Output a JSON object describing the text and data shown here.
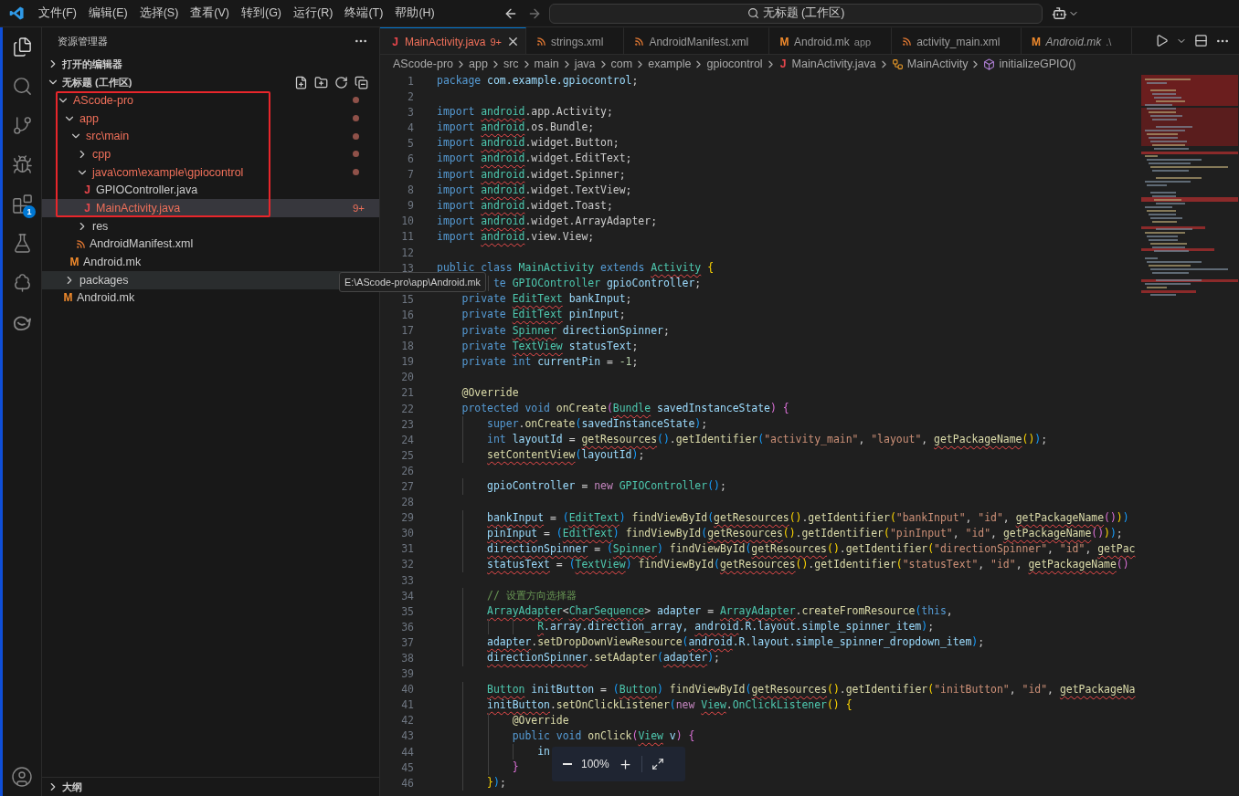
{
  "title_bar": {
    "menu": [
      "文件(F)",
      "编辑(E)",
      "选择(S)",
      "查看(V)",
      "转到(G)",
      "运行(R)",
      "终端(T)",
      "帮助(H)"
    ],
    "command_center": "无标题 (工作区)"
  },
  "activity_bar": {
    "items": [
      {
        "kind": "files",
        "selected": true
      },
      {
        "kind": "search",
        "selected": false
      },
      {
        "kind": "scm",
        "selected": false
      },
      {
        "kind": "debug",
        "selected": false
      },
      {
        "kind": "extensions",
        "selected": false,
        "badge": "1"
      },
      {
        "kind": "testing",
        "selected": false
      },
      {
        "kind": "tree",
        "selected": false
      },
      {
        "kind": "whale",
        "selected": false
      }
    ]
  },
  "sidebar": {
    "title": "资源管理器",
    "sections": [
      {
        "title": "打开的编辑器",
        "expanded": false
      },
      {
        "title": "无标题 (工作区)",
        "expanded": true,
        "tree": [
          {
            "name": "AScode-pro",
            "kind": "folder",
            "expanded": true,
            "modified": true,
            "selected": false,
            "hovered": false,
            "children": [
              {
                "name": "app",
                "kind": "folder",
                "expanded": true,
                "modified": true,
                "selected": false,
                "hovered": false,
                "children": [
                  {
                    "name": "src\\main",
                    "kind": "folder",
                    "expanded": true,
                    "modified": true,
                    "selected": false,
                    "hovered": false,
                    "children": [
                      {
                        "name": "cpp",
                        "kind": "folder",
                        "expanded": false,
                        "modified": true,
                        "selected": false,
                        "hovered": false
                      },
                      {
                        "name": "java\\com\\example\\gpiocontrol",
                        "kind": "folder",
                        "expanded": true,
                        "modified": true,
                        "selected": false,
                        "hovered": false,
                        "children": [
                          {
                            "name": "GPIOController.java",
                            "kind": "java",
                            "icon": "J",
                            "modified": false,
                            "selected": false,
                            "hovered": false
                          },
                          {
                            "name": "MainActivity.java",
                            "kind": "java",
                            "icon": "J",
                            "modified": true,
                            "problems": "9+",
                            "selected": true,
                            "hovered": false
                          }
                        ]
                      },
                      {
                        "name": "res",
                        "kind": "folder",
                        "expanded": false,
                        "modified": false,
                        "selected": false,
                        "hovered": false
                      },
                      {
                        "name": "AndroidManifest.xml",
                        "kind": "xml",
                        "modified": false,
                        "selected": false,
                        "hovered": false
                      }
                    ]
                  },
                  {
                    "name": "Android.mk",
                    "kind": "mk",
                    "icon": "M",
                    "modified": false,
                    "selected": false,
                    "hovered": false
                  }
                ]
              },
              {
                "name": "packages",
                "kind": "folder",
                "expanded": false,
                "modified": false,
                "selected": false,
                "hovered": true
              },
              {
                "name": "Android.mk",
                "kind": "mk",
                "icon": "M",
                "modified": false,
                "selected": false,
                "hovered": false
              }
            ]
          }
        ]
      }
    ],
    "outline": {
      "title": "大纲",
      "expanded": false
    }
  },
  "editor": {
    "tabs": [
      {
        "label": "MainActivity.java",
        "kind": "java",
        "icon": "J",
        "problems": "9+",
        "selected": true,
        "preview": false
      },
      {
        "label": "strings.xml",
        "kind": "xml",
        "selected": false,
        "preview": false
      },
      {
        "label": "AndroidManifest.xml",
        "kind": "xml",
        "selected": false,
        "preview": false
      },
      {
        "label": "Android.mk",
        "description": "app",
        "kind": "mk",
        "icon": "M",
        "selected": false,
        "preview": false
      },
      {
        "label": "activity_main.xml",
        "kind": "xml",
        "selected": false,
        "preview": false
      },
      {
        "label": "Android.mk",
        "description": ".\\",
        "kind": "mk",
        "icon": "M",
        "selected": false,
        "preview": true
      }
    ],
    "breadcrumb": [
      {
        "label": "AScode-pro",
        "kind": "folder"
      },
      {
        "label": "app",
        "kind": "folder"
      },
      {
        "label": "src",
        "kind": "folder"
      },
      {
        "label": "main",
        "kind": "folder"
      },
      {
        "label": "java",
        "kind": "folder"
      },
      {
        "label": "com",
        "kind": "folder"
      },
      {
        "label": "example",
        "kind": "folder"
      },
      {
        "label": "gpiocontrol",
        "kind": "folder"
      },
      {
        "label": "MainActivity.java",
        "kind": "java",
        "icon": "J"
      },
      {
        "label": "MainActivity",
        "kind": "class"
      },
      {
        "label": "initializeGPIO()",
        "kind": "method"
      }
    ],
    "lines": [
      {
        "number": "1",
        "tokens": [
          {
            "text": "package ",
            "kind": "kw"
          },
          {
            "text": "com.example.gpiocontrol",
            "kind": "var"
          },
          {
            "text": ";",
            "kind": "txt"
          }
        ]
      },
      {
        "number": "2"
      },
      {
        "number": "3",
        "tokens": [
          {
            "text": "import ",
            "kind": "kw"
          },
          {
            "text": "android",
            "kind": "type_err"
          },
          {
            "text": ".app.Activity;",
            "kind": "txt"
          }
        ]
      },
      {
        "number": "4",
        "tokens": [
          {
            "text": "import ",
            "kind": "kw"
          },
          {
            "text": "android",
            "kind": "type_err"
          },
          {
            "text": ".os.Bundle;",
            "kind": "txt"
          }
        ]
      },
      {
        "number": "5",
        "tokens": [
          {
            "text": "import ",
            "kind": "kw"
          },
          {
            "text": "android",
            "kind": "type_err"
          },
          {
            "text": ".widget.Button;",
            "kind": "txt"
          }
        ]
      },
      {
        "number": "6",
        "tokens": [
          {
            "text": "import ",
            "kind": "kw"
          },
          {
            "text": "android",
            "kind": "type_err"
          },
          {
            "text": ".widget.EditText;",
            "kind": "txt"
          }
        ]
      },
      {
        "number": "7",
        "tokens": [
          {
            "text": "import ",
            "kind": "kw"
          },
          {
            "text": "android",
            "kind": "type_err"
          },
          {
            "text": ".widget.Spinner;",
            "kind": "txt"
          }
        ]
      },
      {
        "number": "8",
        "tokens": [
          {
            "text": "import ",
            "kind": "kw"
          },
          {
            "text": "android",
            "kind": "type_err"
          },
          {
            "text": ".widget.TextView;",
            "kind": "txt"
          }
        ]
      },
      {
        "number": "9",
        "tokens": [
          {
            "text": "import ",
            "kind": "kw"
          },
          {
            "text": "android",
            "kind": "type_err"
          },
          {
            "text": ".widget.Toast;",
            "kind": "txt"
          }
        ]
      },
      {
        "number": "10",
        "tokens": [
          {
            "text": "import ",
            "kind": "kw"
          },
          {
            "text": "android",
            "kind": "type_err"
          },
          {
            "text": ".widget.ArrayAdapter;",
            "kind": "txt"
          }
        ]
      },
      {
        "number": "11",
        "tokens": [
          {
            "text": "import ",
            "kind": "kw"
          },
          {
            "text": "android",
            "kind": "type_err"
          },
          {
            "text": ".view.View;",
            "kind": "txt"
          }
        ]
      },
      {
        "number": "12"
      },
      {
        "number": "13",
        "tokens": [
          {
            "text": "public class ",
            "kind": "kw"
          },
          {
            "text": "MainActivity ",
            "kind": "type"
          },
          {
            "text": "extends ",
            "kind": "kw"
          },
          {
            "text": "Activity",
            "kind": "type_err"
          },
          {
            "text": " {",
            "kind": "p1"
          }
        ]
      },
      {
        "tokens": [
          {
            "text": "         te ",
            "kind": "kw"
          },
          {
            "text": "GPIOController ",
            "kind": "type"
          },
          {
            "text": "gpioController",
            "kind": "var"
          },
          {
            "text": ";",
            "kind": "txt"
          }
        ]
      },
      {
        "number": "15",
        "tokens": [
          {
            "text": "    private ",
            "kind": "kw"
          },
          {
            "text": "EditText",
            "kind": "type_err"
          },
          {
            "text": " bankInput",
            "kind": "var"
          },
          {
            "text": ";",
            "kind": "txt"
          }
        ]
      },
      {
        "number": "16",
        "tokens": [
          {
            "text": "    private ",
            "kind": "kw"
          },
          {
            "text": "EditText",
            "kind": "type_err"
          },
          {
            "text": " pinInput",
            "kind": "var"
          },
          {
            "text": ";",
            "kind": "txt"
          }
        ]
      },
      {
        "number": "17",
        "tokens": [
          {
            "text": "    private ",
            "kind": "kw"
          },
          {
            "text": "Spinner",
            "kind": "type_err"
          },
          {
            "text": " directionSpinner",
            "kind": "var"
          },
          {
            "text": ";",
            "kind": "txt"
          }
        ]
      },
      {
        "number": "18",
        "tokens": [
          {
            "text": "    private ",
            "kind": "kw"
          },
          {
            "text": "TextView",
            "kind": "type_err"
          },
          {
            "text": " statusText",
            "kind": "var"
          },
          {
            "text": ";",
            "kind": "txt"
          }
        ]
      },
      {
        "number": "19",
        "tokens": [
          {
            "text": "    private int ",
            "kind": "kw"
          },
          {
            "text": "currentPin",
            "kind": "var"
          },
          {
            "text": " = ",
            "kind": "txt"
          },
          {
            "text": "-1",
            "kind": "num"
          },
          {
            "text": ";",
            "kind": "txt"
          }
        ]
      },
      {
        "number": "20"
      },
      {
        "number": "21",
        "tokens": [
          {
            "text": "    @Override",
            "kind": "ann"
          }
        ]
      },
      {
        "number": "22",
        "tokens": [
          {
            "text": "    protected void ",
            "kind": "kw"
          },
          {
            "text": "onCreate",
            "kind": "fn"
          },
          {
            "text": "(",
            "kind": "p2"
          },
          {
            "text": "Bundle",
            "kind": "type_err"
          },
          {
            "text": " savedInstanceState",
            "kind": "var"
          },
          {
            "text": ")",
            "kind": "p2"
          },
          {
            "text": " {",
            "kind": "p2"
          }
        ]
      },
      {
        "number": "23",
        "tokens": [
          {
            "text": "        super",
            "kind": "kw"
          },
          {
            "text": ".",
            "kind": "txt"
          },
          {
            "text": "onCreate",
            "kind": "fn"
          },
          {
            "text": "(",
            "kind": "p3"
          },
          {
            "text": "savedInstanceState",
            "kind": "var"
          },
          {
            "text": ")",
            "kind": "p3"
          },
          {
            "text": ";",
            "kind": "txt"
          }
        ]
      },
      {
        "number": "24",
        "tokens": [
          {
            "text": "        int ",
            "kind": "kw"
          },
          {
            "text": "layoutId",
            "kind": "var"
          },
          {
            "text": " = ",
            "kind": "txt"
          },
          {
            "text": "getResources",
            "kind": "fn_err"
          },
          {
            "text": "()",
            "kind": "p3"
          },
          {
            "text": ".",
            "kind": "txt"
          },
          {
            "text": "getIdentifier",
            "kind": "fn"
          },
          {
            "text": "(",
            "kind": "p3"
          },
          {
            "text": "\"activity_main\"",
            "kind": "str"
          },
          {
            "text": ", ",
            "kind": "txt"
          },
          {
            "text": "\"layout\"",
            "kind": "str"
          },
          {
            "text": ", ",
            "kind": "txt"
          },
          {
            "text": "getPackageName",
            "kind": "fn_err"
          },
          {
            "text": "()",
            "kind": "p1"
          },
          {
            "text": ")",
            "kind": "p3"
          },
          {
            "text": ";",
            "kind": "txt"
          }
        ]
      },
      {
        "number": "25",
        "tokens": [
          {
            "text": "        setContentView",
            "kind": "fn_err"
          },
          {
            "text": "(",
            "kind": "p3"
          },
          {
            "text": "layoutId",
            "kind": "var"
          },
          {
            "text": ")",
            "kind": "p3"
          },
          {
            "text": ";",
            "kind": "txt"
          }
        ]
      },
      {
        "number": "26"
      },
      {
        "number": "27",
        "tokens": [
          {
            "text": "        gpioController",
            "kind": "var"
          },
          {
            "text": " = ",
            "kind": "txt"
          },
          {
            "text": "new ",
            "kind": "ctl"
          },
          {
            "text": "GPIOController",
            "kind": "type"
          },
          {
            "text": "()",
            "kind": "p3"
          },
          {
            "text": ";",
            "kind": "txt"
          }
        ]
      },
      {
        "number": "28"
      },
      {
        "number": "29",
        "tokens": [
          {
            "text": "        bankInput",
            "kind": "var_err"
          },
          {
            "text": " = ",
            "kind": "txt"
          },
          {
            "text": "(",
            "kind": "p3"
          },
          {
            "text": "EditText",
            "kind": "type_err"
          },
          {
            "text": ") ",
            "kind": "p3"
          },
          {
            "text": "findViewById",
            "kind": "fn"
          },
          {
            "text": "(",
            "kind": "p3"
          },
          {
            "text": "getResources",
            "kind": "fn_err"
          },
          {
            "text": "()",
            "kind": "p1"
          },
          {
            "text": ".",
            "kind": "txt"
          },
          {
            "text": "getIdentifier",
            "kind": "fn"
          },
          {
            "text": "(",
            "kind": "p1"
          },
          {
            "text": "\"bankInput\"",
            "kind": "str"
          },
          {
            "text": ", ",
            "kind": "txt"
          },
          {
            "text": "\"id\"",
            "kind": "str"
          },
          {
            "text": ", ",
            "kind": "txt"
          },
          {
            "text": "getPackageName",
            "kind": "fn_err"
          },
          {
            "text": "()",
            "kind": "p2"
          },
          {
            "text": ")",
            "kind": "p1"
          },
          {
            "text": ")",
            "kind": "p3"
          }
        ]
      },
      {
        "number": "30",
        "tokens": [
          {
            "text": "        pinInput",
            "kind": "var_err"
          },
          {
            "text": " = ",
            "kind": "txt"
          },
          {
            "text": "(",
            "kind": "p3"
          },
          {
            "text": "EditText",
            "kind": "type_err"
          },
          {
            "text": ") ",
            "kind": "p3"
          },
          {
            "text": "findViewById",
            "kind": "fn"
          },
          {
            "text": "(",
            "kind": "p3"
          },
          {
            "text": "getResources",
            "kind": "fn_err"
          },
          {
            "text": "()",
            "kind": "p1"
          },
          {
            "text": ".",
            "kind": "txt"
          },
          {
            "text": "getIdentifier",
            "kind": "fn"
          },
          {
            "text": "(",
            "kind": "p1"
          },
          {
            "text": "\"pinInput\"",
            "kind": "str"
          },
          {
            "text": ", ",
            "kind": "txt"
          },
          {
            "text": "\"id\"",
            "kind": "str"
          },
          {
            "text": ", ",
            "kind": "txt"
          },
          {
            "text": "getPackageName",
            "kind": "fn_err"
          },
          {
            "text": "()",
            "kind": "p2"
          },
          {
            "text": ")",
            "kind": "p1"
          },
          {
            "text": ")",
            "kind": "p3"
          },
          {
            "text": ";",
            "kind": "txt"
          }
        ]
      },
      {
        "number": "31",
        "tokens": [
          {
            "text": "        directionSpinner",
            "kind": "var_err"
          },
          {
            "text": " = ",
            "kind": "txt"
          },
          {
            "text": "(",
            "kind": "p3"
          },
          {
            "text": "Spinner",
            "kind": "type_err"
          },
          {
            "text": ") ",
            "kind": "p3"
          },
          {
            "text": "findViewById",
            "kind": "fn"
          },
          {
            "text": "(",
            "kind": "p3"
          },
          {
            "text": "getResources",
            "kind": "fn_err"
          },
          {
            "text": "()",
            "kind": "p1"
          },
          {
            "text": ".",
            "kind": "txt"
          },
          {
            "text": "getIdentifier",
            "kind": "fn"
          },
          {
            "text": "(",
            "kind": "p1"
          },
          {
            "text": "\"directionSpinner\"",
            "kind": "str"
          },
          {
            "text": ", ",
            "kind": "txt"
          },
          {
            "text": "\"id\"",
            "kind": "str"
          },
          {
            "text": ", ",
            "kind": "txt"
          },
          {
            "text": "getPac",
            "kind": "fn_err"
          }
        ]
      },
      {
        "number": "32",
        "tokens": [
          {
            "text": "        statusText",
            "kind": "var_err"
          },
          {
            "text": " = ",
            "kind": "txt"
          },
          {
            "text": "(",
            "kind": "p3"
          },
          {
            "text": "TextView",
            "kind": "type_err"
          },
          {
            "text": ") ",
            "kind": "p3"
          },
          {
            "text": "findViewById",
            "kind": "fn"
          },
          {
            "text": "(",
            "kind": "p3"
          },
          {
            "text": "getResources",
            "kind": "fn_err"
          },
          {
            "text": "()",
            "kind": "p1"
          },
          {
            "text": ".",
            "kind": "txt"
          },
          {
            "text": "getIdentifier",
            "kind": "fn"
          },
          {
            "text": "(",
            "kind": "p1"
          },
          {
            "text": "\"statusText\"",
            "kind": "str"
          },
          {
            "text": ", ",
            "kind": "txt"
          },
          {
            "text": "\"id\"",
            "kind": "str"
          },
          {
            "text": ", ",
            "kind": "txt"
          },
          {
            "text": "getPackageName",
            "kind": "fn_err"
          },
          {
            "text": "()",
            "kind": "p2"
          }
        ]
      },
      {
        "number": "33"
      },
      {
        "number": "34",
        "tokens": [
          {
            "text": "        // 设置方向选择器",
            "kind": "cmt"
          }
        ]
      },
      {
        "number": "35",
        "tokens": [
          {
            "text": "        ArrayAdapter",
            "kind": "type_err"
          },
          {
            "text": "<",
            "kind": "txt"
          },
          {
            "text": "CharSequence",
            "kind": "type_err"
          },
          {
            "text": "> ",
            "kind": "txt"
          },
          {
            "text": "adapter",
            "kind": "var"
          },
          {
            "text": " = ",
            "kind": "txt"
          },
          {
            "text": "ArrayAdapter",
            "kind": "type_err"
          },
          {
            "text": ".",
            "kind": "txt"
          },
          {
            "text": "createFromResource",
            "kind": "fn"
          },
          {
            "text": "(",
            "kind": "p3"
          },
          {
            "text": "this",
            "kind": "kw"
          },
          {
            "text": ",",
            "kind": "txt"
          }
        ]
      },
      {
        "number": "36",
        "tokens": [
          {
            "text": "                R",
            "kind": "type_err"
          },
          {
            "text": ".array.direction_array, ",
            "kind": "var"
          },
          {
            "text": "android",
            "kind": "var_err"
          },
          {
            "text": ".R.layout.simple_spinner_item",
            "kind": "var"
          },
          {
            "text": ")",
            "kind": "p3"
          },
          {
            "text": ";",
            "kind": "txt"
          }
        ]
      },
      {
        "number": "37",
        "tokens": [
          {
            "text": "        adapter",
            "kind": "var_err"
          },
          {
            "text": ".",
            "kind": "txt"
          },
          {
            "text": "setDropDownViewResource",
            "kind": "fn"
          },
          {
            "text": "(",
            "kind": "p3"
          },
          {
            "text": "android",
            "kind": "var_err"
          },
          {
            "text": ".R.layout.simple_spinner_dropdown_item",
            "kind": "var"
          },
          {
            "text": ")",
            "kind": "p3"
          },
          {
            "text": ";",
            "kind": "txt"
          }
        ]
      },
      {
        "number": "38",
        "tokens": [
          {
            "text": "        directionSpinner",
            "kind": "var_err"
          },
          {
            "text": ".",
            "kind": "txt"
          },
          {
            "text": "setAdapter",
            "kind": "fn"
          },
          {
            "text": "(",
            "kind": "p3"
          },
          {
            "text": "adapter",
            "kind": "var_err"
          },
          {
            "text": ")",
            "kind": "p3"
          },
          {
            "text": ";",
            "kind": "txt"
          }
        ]
      },
      {
        "number": "39"
      },
      {
        "number": "40",
        "tokens": [
          {
            "text": "        Button",
            "kind": "type_err"
          },
          {
            "text": " initButton",
            "kind": "var"
          },
          {
            "text": " = ",
            "kind": "txt"
          },
          {
            "text": "(",
            "kind": "p3"
          },
          {
            "text": "Button",
            "kind": "type_err"
          },
          {
            "text": ") ",
            "kind": "p3"
          },
          {
            "text": "findViewById",
            "kind": "fn"
          },
          {
            "text": "(",
            "kind": "p3"
          },
          {
            "text": "getResources",
            "kind": "fn_err"
          },
          {
            "text": "()",
            "kind": "p1"
          },
          {
            "text": ".",
            "kind": "txt"
          },
          {
            "text": "getIdentifier",
            "kind": "fn"
          },
          {
            "text": "(",
            "kind": "p1"
          },
          {
            "text": "\"initButton\"",
            "kind": "str"
          },
          {
            "text": ", ",
            "kind": "txt"
          },
          {
            "text": "\"id\"",
            "kind": "str"
          },
          {
            "text": ", ",
            "kind": "txt"
          },
          {
            "text": "getPackageNa",
            "kind": "fn_err"
          }
        ]
      },
      {
        "number": "41",
        "tokens": [
          {
            "text": "        initButton",
            "kind": "var_err"
          },
          {
            "text": ".",
            "kind": "txt"
          },
          {
            "text": "setOnClickListener",
            "kind": "fn"
          },
          {
            "text": "(",
            "kind": "p3"
          },
          {
            "text": "new ",
            "kind": "ctl"
          },
          {
            "text": "View",
            "kind": "type_err"
          },
          {
            "text": ".",
            "kind": "txt"
          },
          {
            "text": "OnClickListener",
            "kind": "type"
          },
          {
            "text": "()",
            "kind": "p1"
          },
          {
            "text": " {",
            "kind": "p1"
          }
        ]
      },
      {
        "number": "42",
        "tokens": [
          {
            "text": "            @Override",
            "kind": "ann"
          }
        ]
      },
      {
        "number": "43",
        "tokens": [
          {
            "text": "            public void ",
            "kind": "kw"
          },
          {
            "text": "onClick",
            "kind": "fn"
          },
          {
            "text": "(",
            "kind": "p2"
          },
          {
            "text": "View",
            "kind": "type_err"
          },
          {
            "text": " v",
            "kind": "var"
          },
          {
            "text": ")",
            "kind": "p2"
          },
          {
            "text": " {",
            "kind": "p2"
          }
        ]
      },
      {
        "number": "44",
        "tokens": [
          {
            "text": "                in",
            "kind": "var"
          }
        ]
      },
      {
        "number": "45",
        "tokens": [
          {
            "text": "            }",
            "kind": "p2"
          }
        ]
      },
      {
        "number": "46",
        "tokens": [
          {
            "text": "        }",
            "kind": "p1"
          },
          {
            "text": ")",
            "kind": "p3"
          },
          {
            "text": ";",
            "kind": "txt"
          }
        ]
      }
    ]
  },
  "tooltip": "E:\\AScode-pro\\app\\Android.mk",
  "zoom_controls": {
    "value": "100%"
  }
}
